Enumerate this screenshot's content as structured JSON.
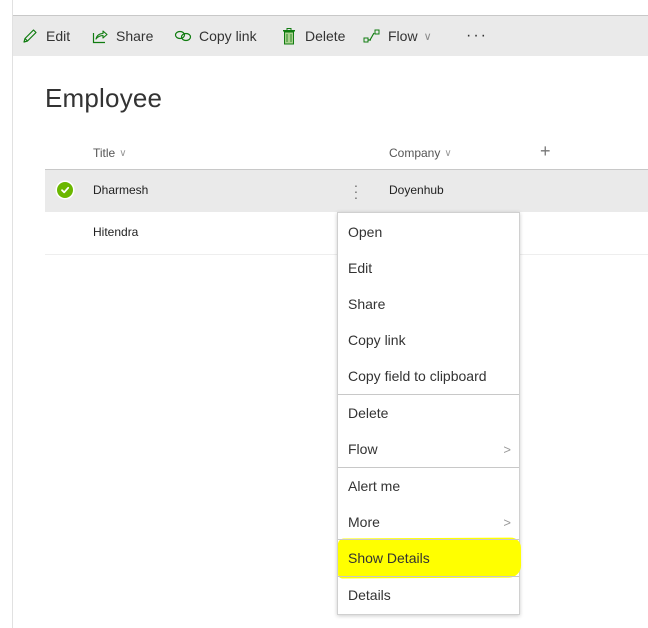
{
  "toolbar": {
    "edit": "Edit",
    "share": "Share",
    "copy_link": "Copy link",
    "delete": "Delete",
    "flow": "Flow",
    "more": "···",
    "accent": "#107c10"
  },
  "list": {
    "title": "Employee",
    "columns": [
      "Title",
      "Company"
    ],
    "add_column": "+",
    "rows": [
      {
        "title": "Dharmesh",
        "company": "Doyenhub",
        "selected": true
      },
      {
        "title": "Hitendra",
        "company": "",
        "selected": false
      }
    ]
  },
  "context_menu": {
    "items": [
      {
        "label": "Open"
      },
      {
        "label": "Edit"
      },
      {
        "label": "Share"
      },
      {
        "label": "Copy link"
      },
      {
        "label": "Copy field to clipboard"
      },
      {
        "label": "Delete"
      },
      {
        "label": "Flow",
        "submenu": true
      },
      {
        "label": "Alert me"
      },
      {
        "label": "More",
        "submenu": true
      },
      {
        "label": "Show Details",
        "highlighted": true
      },
      {
        "label": "Details"
      }
    ],
    "submenu_glyph": ">",
    "highlight_color": "#ffff00"
  }
}
